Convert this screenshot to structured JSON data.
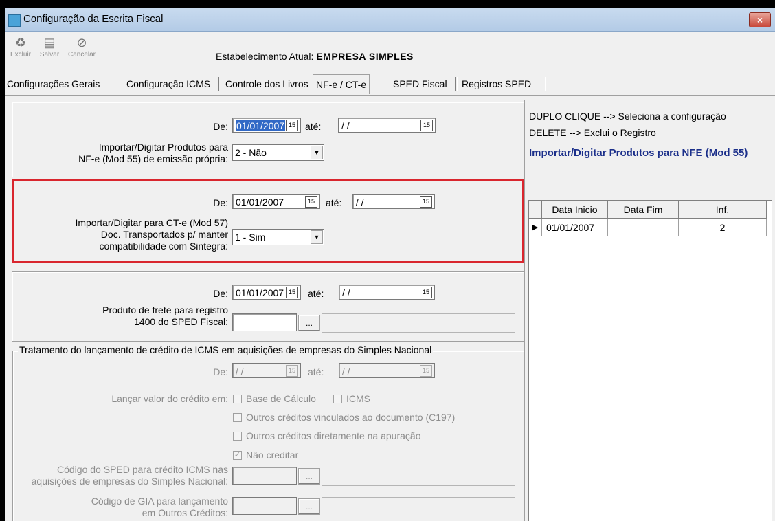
{
  "window": {
    "title": "Configuração da Escrita Fiscal",
    "close_glyph": "×"
  },
  "toolbar": {
    "excluir": "Excluir",
    "salvar": "Salvar",
    "cancelar": "Cancelar",
    "estab_label": "Estabelecimento Atual:",
    "estab_value": "EMPRESA SIMPLES"
  },
  "tabs": [
    "Configurações Gerais",
    "Configuração ICMS",
    "Controle dos Livros",
    "NF-e / CT-e",
    "SPED Fiscal",
    "Registros SPED"
  ],
  "section1": {
    "de_label": "De:",
    "de_value": "01/01/2007",
    "ate_label": "até:",
    "ate_value": "/ /",
    "field_label_1": "Importar/Digitar Produtos para",
    "field_label_2": "NF-e (Mod 55) de emissão própria:",
    "combo_value": "2 - Não"
  },
  "section2": {
    "de_label": "De:",
    "de_value": "01/01/2007",
    "ate_label": "até:",
    "ate_value": "/ /",
    "field_label_1": "Importar/Digitar para CT-e (Mod 57)",
    "field_label_2": "Doc. Transportados p/ manter",
    "field_label_3": "compatibilidade com Sintegra:",
    "combo_value": "1 - Sim"
  },
  "section3": {
    "de_label": "De:",
    "de_value": "01/01/2007",
    "ate_label": "até:",
    "ate_value": "/ /",
    "field_label_1": "Produto de frete para registro",
    "field_label_2": "1400 do SPED Fiscal:",
    "ellipsis": "..."
  },
  "section4": {
    "caption": "Tratamento do lançamento de crédito de ICMS em aquisições de empresas do Simples Nacional",
    "de_label": "De:",
    "de_value": "/ /",
    "ate_label": "até:",
    "ate_value": "/ /",
    "lancar_label": "Lançar valor do crédito em:",
    "opt_base": "Base de Cálculo",
    "opt_icms": "ICMS",
    "opt_outros_doc": "Outros créditos vinculados ao documento (C197)",
    "opt_outros_ap": "Outros créditos diretamente na apuração",
    "opt_nao": "Não creditar",
    "sped_label_1": "Código do SPED para crédito ICMS nas",
    "sped_label_2": "aquisições de empresas do Simples Nacional:",
    "gia_label_1": "Código de GIA para lançamento",
    "gia_label_2": "em Outros Créditos:",
    "ellipsis": "..."
  },
  "right_panel": {
    "hint1": "DUPLO CLIQUE --> Seleciona a configuração",
    "hint2": "DELETE --> Exclui o Registro",
    "title": "Importar/Digitar Produtos para NFE (Mod 55)",
    "columns": [
      "Data Inicio",
      "Data Fim",
      "Inf."
    ],
    "rows": [
      {
        "inicio": "01/01/2007",
        "fim": "",
        "inf": "2"
      }
    ]
  },
  "icons": {
    "calendar": "15",
    "dropdown": "▼",
    "row_pointer": "▶",
    "check": "✓"
  },
  "colors": {
    "highlight_border": "#d9262e",
    "right_title": "#1b2f8a",
    "selection": "#3169c6"
  }
}
